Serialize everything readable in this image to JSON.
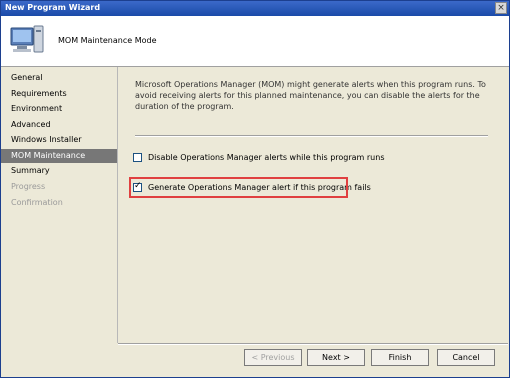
{
  "window": {
    "title": "New Program Wizard",
    "close_glyph": "×"
  },
  "header": {
    "title": "MOM Maintenance Mode",
    "icon": "computer-icon"
  },
  "nav": {
    "items": [
      {
        "label": "General",
        "state": "normal"
      },
      {
        "label": "Requirements",
        "state": "normal"
      },
      {
        "label": "Environment",
        "state": "normal"
      },
      {
        "label": "Advanced",
        "state": "normal"
      },
      {
        "label": "Windows Installer",
        "state": "normal"
      },
      {
        "label": "MOM Maintenance",
        "state": "active"
      },
      {
        "label": "Summary",
        "state": "normal"
      },
      {
        "label": "Progress",
        "state": "disabled"
      },
      {
        "label": "Confirmation",
        "state": "disabled"
      }
    ]
  },
  "content": {
    "description": "Microsoft Operations Manager (MOM) might generate alerts when this program runs. To avoid receiving alerts for this planned maintenance, you can disable the alerts for the duration of the program.",
    "disable_alerts": {
      "label": "Disable Operations Manager alerts while this program runs",
      "checked": false
    },
    "generate_alert": {
      "label": "Generate Operations Manager alert if this program fails",
      "checked": true
    }
  },
  "buttons": {
    "previous": "< Previous",
    "next": "Next >",
    "finish": "Finish",
    "cancel": "Cancel"
  },
  "colors": {
    "highlight": "#e04040",
    "active_nav": "#777777",
    "titlebar": "#1a4aa8"
  }
}
